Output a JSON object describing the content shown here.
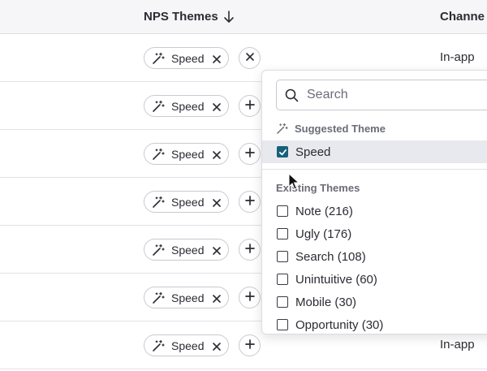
{
  "table": {
    "columns": [
      {
        "label": "NPS Themes"
      },
      {
        "label": "Channe"
      }
    ],
    "rows": [
      {
        "chip": "Speed",
        "action": "remove",
        "channel": "In-app"
      },
      {
        "chip": "Speed",
        "action": "add",
        "channel": ""
      },
      {
        "chip": "Speed",
        "action": "add",
        "channel": ""
      },
      {
        "chip": "Speed",
        "action": "add",
        "channel": ""
      },
      {
        "chip": "Speed",
        "action": "add",
        "channel": ""
      },
      {
        "chip": "Speed",
        "action": "add",
        "channel": ""
      },
      {
        "chip": "Speed",
        "action": "add",
        "channel": "In-app"
      }
    ]
  },
  "dropdown": {
    "search_placeholder": "Search",
    "suggested_label": "Suggested Theme",
    "suggested_options": [
      {
        "label": "Speed",
        "checked": true
      }
    ],
    "existing_label": "Existing Themes",
    "existing_options": [
      {
        "label": "Note (216)",
        "checked": false
      },
      {
        "label": "Ugly (176)",
        "checked": false
      },
      {
        "label": "Search (108)",
        "checked": false
      },
      {
        "label": "Unintuitive (60)",
        "checked": false
      },
      {
        "label": "Mobile (30)",
        "checked": false
      },
      {
        "label": "Opportunity (30)",
        "checked": false
      }
    ]
  },
  "colors": {
    "checkbox_checked": "#17607a",
    "selected_row_bg": "#e7e9ee",
    "header_bg": "#f6f6f8"
  }
}
